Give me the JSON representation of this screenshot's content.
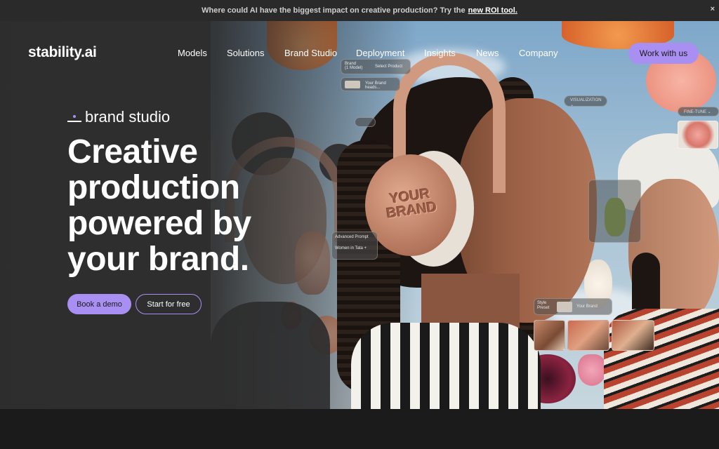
{
  "banner": {
    "text": "Where could AI have the biggest impact on creative production? Try the",
    "link": "new ROI tool.",
    "close": "×"
  },
  "header": {
    "logo": "stability.ai",
    "nav": [
      "Models",
      "Solutions",
      "Brand Studio",
      "Deployment",
      "Insights",
      "News",
      "Company"
    ],
    "cta": "Work with us"
  },
  "hero": {
    "eyebrow": "brand studio",
    "headline": [
      "Creative",
      "production",
      "powered by",
      "your brand."
    ],
    "primary_button": "Book a demo",
    "secondary_button": "Start for free"
  },
  "scene": {
    "cup_text_line1": "YOUR",
    "cup_text_line2": "BRAND",
    "panel_brand_label": "Brand\n(1 Model)",
    "panel_select_product": "Select Product",
    "panel_your_brand": "Your Brand heads...",
    "panel_visualization": "VISUALIZATION",
    "panel_advanced": "Advanced Prompt",
    "panel_women": "Women in Tata +",
    "panel_style_preset": "Style Preset",
    "panel_your_brand2": "Your Brand",
    "panel_fine_tune": "FINE-TUNE"
  },
  "colors": {
    "accent": "#a98ff2",
    "banner_bg": "#2a2a2a",
    "hero_dark": "#2d2d2d"
  }
}
